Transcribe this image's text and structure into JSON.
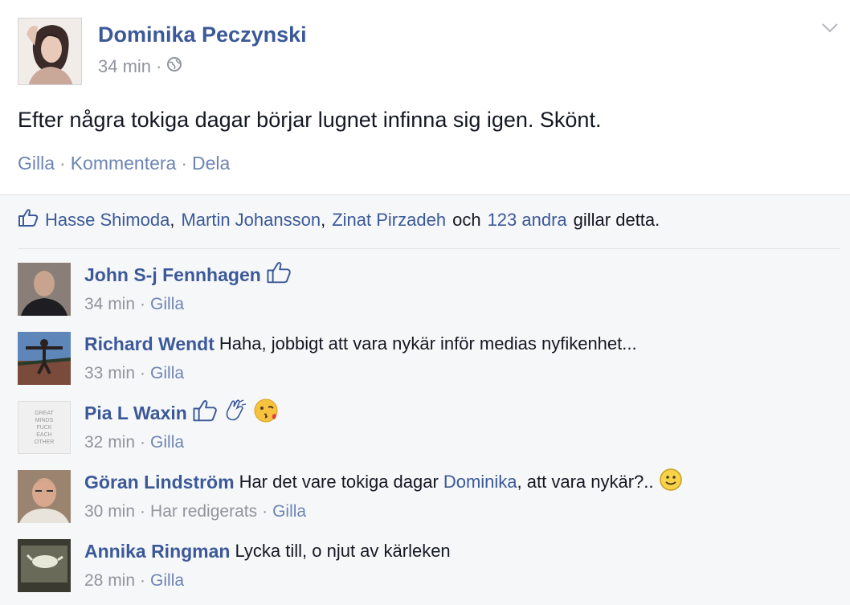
{
  "post": {
    "author": "Dominika Peczynski",
    "time": "34 min",
    "meta_sep": "·",
    "text": "Efter några tokiga dagar börjar lugnet infinna sig igen. Skönt.",
    "actions": [
      "Gilla",
      "Kommentera",
      "Dela"
    ],
    "action_sep": "·"
  },
  "likes": {
    "names": [
      "Hasse Shimoda",
      "Martin Johansson",
      "Zinat Pirzadeh"
    ],
    "comma": ",",
    "och": "och",
    "others": "123 andra",
    "suffix": "gillar detta."
  },
  "comments": [
    {
      "name": "John S-j Fennhagen",
      "text": "",
      "time": "34 min",
      "actions": [
        "Gilla"
      ]
    },
    {
      "name": "Richard Wendt",
      "text": "Haha, jobbigt att vara nykär inför medias nyfikenhet...",
      "time": "33 min",
      "actions": [
        "Gilla"
      ]
    },
    {
      "name": "Pia L Waxin",
      "text": "",
      "time": "32 min",
      "actions": [
        "Gilla"
      ]
    },
    {
      "name": "Göran Lindström",
      "text_before": "Har det vare tokiga dagar",
      "mention": "Dominika",
      "text_after": ", att vara nykär?..",
      "time": "30 min",
      "edited": "Har redigerats",
      "actions": [
        "Gilla"
      ]
    },
    {
      "name": "Annika Ringman",
      "text": "Lycka till, o njut av kärleken",
      "time": "28 min",
      "actions": [
        "Gilla"
      ]
    }
  ],
  "meta_sep": "·",
  "avatar_text": "GREAT MINDS FUCK EACH OTHER",
  "colors": {
    "link": "#3b5998",
    "muted": "#90949c",
    "background": "#f6f7f9"
  },
  "icons": [
    "globe-icon",
    "chevron-down-icon",
    "thumbs-up-icon",
    "clapping-hands-icon",
    "kissing-face-icon",
    "smiley-face-icon"
  ]
}
